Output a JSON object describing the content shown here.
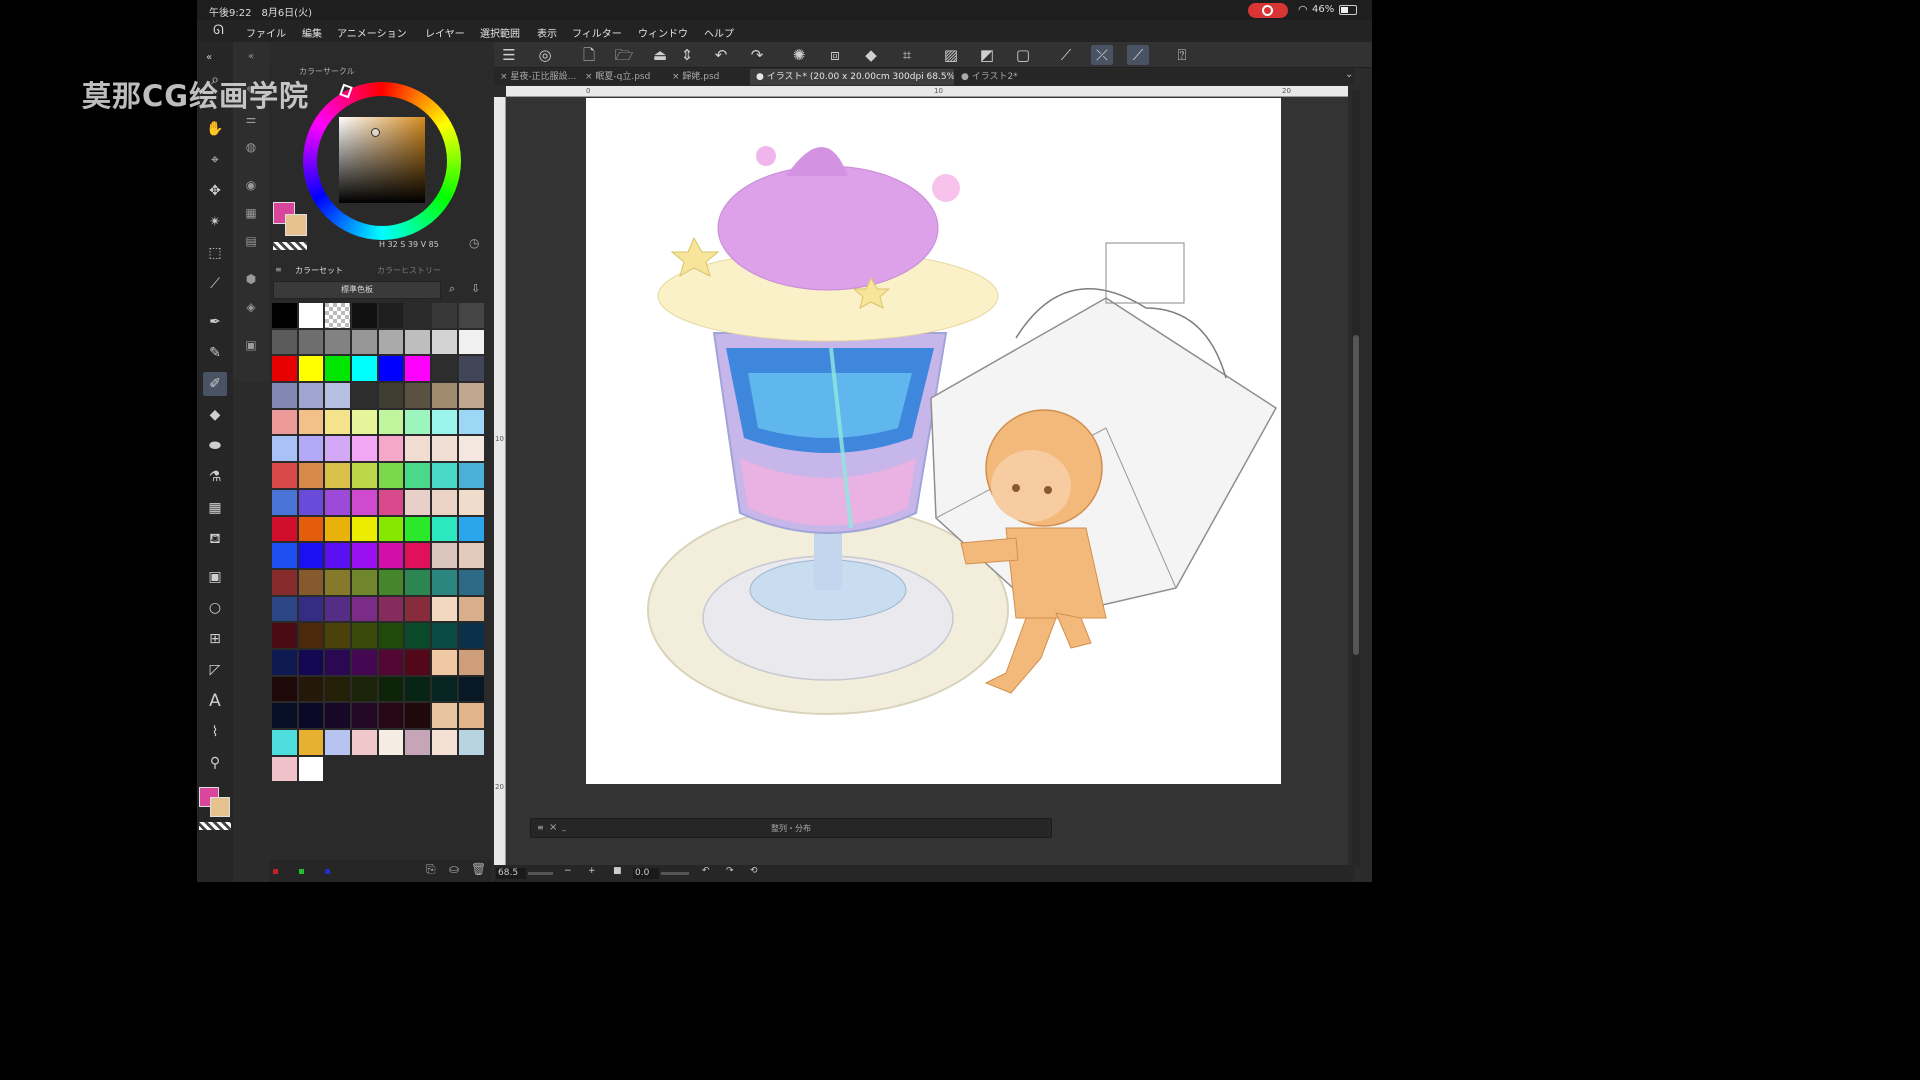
{
  "status_bar": {
    "time": "午後9:22　8月6日(火)",
    "battery": "46%"
  },
  "menu": [
    "ファイル",
    "編集",
    "アニメーション",
    "レイヤー",
    "選択範囲",
    "表示",
    "フィルター",
    "ウィンドウ",
    "ヘルプ"
  ],
  "tabs": [
    {
      "label": "× 星夜-正比服設..."
    },
    {
      "label": "× 眠夏-q立.psd"
    },
    {
      "label": "× 歸姥.psd"
    },
    {
      "label": "● イラスト* (20.00 x 20.00cm 300dpi 68.5%)"
    },
    {
      "label": "● イラスト2*"
    }
  ],
  "ruler": {
    "top": [
      "0",
      "10",
      "20"
    ],
    "left": [
      "10",
      "20"
    ]
  },
  "color_panel": {
    "title": "カラーサークル",
    "hsv": "H 32  S 39  V 85",
    "main_color": "#d9459a",
    "sub_color": "#e6c38e"
  },
  "color_set": {
    "tab_active": "カラーセット",
    "tab_inactive": "カラーヒストリー",
    "palette_name": "標準色板",
    "swatches": [
      "#000000",
      "#ffffff",
      "checker",
      "#111111",
      "#1e1e1e",
      "#2b2b2b",
      "#383838",
      "#454545",
      "#5a5a5a",
      "#6e6e6e",
      "#828282",
      "#969696",
      "#aaaaaa",
      "#bebebe",
      "#d2d2d2",
      "#f0f0f0",
      "#e60000",
      "#ffff00",
      "#00e600",
      "#00ffff",
      "#0000ff",
      "#ff00ff",
      "#2d2d2d",
      "#404658",
      "#7f87b2",
      "#9ea6cf",
      "#b7bfe0",
      "#2e2e2e",
      "#3f3d32",
      "#5b5140",
      "#a08a6e",
      "#c1a78e",
      "#ef9a9a",
      "#f3c08a",
      "#f5e38c",
      "#e7f59a",
      "#bff59c",
      "#9cf5bd",
      "#9cf5ec",
      "#9cd8f5",
      "#a8c2f7",
      "#b3a8f7",
      "#d2a8f7",
      "#f2a8f5",
      "#f5a8c9",
      "#f0dcd0",
      "#f1ded5",
      "#f3e7e0",
      "#d84a4a",
      "#d88a4a",
      "#d8c04a",
      "#bcd84a",
      "#7bd84a",
      "#4ad88a",
      "#4ad8c6",
      "#4ab0d8",
      "#4a73d8",
      "#6a4ad8",
      "#9d4ad8",
      "#d04ad0",
      "#d84a8c",
      "#e8d0c8",
      "#ead3c5",
      "#f0dccb",
      "#d10e2b",
      "#e35d0b",
      "#e8b20a",
      "#ecec00",
      "#86e800",
      "#2be82b",
      "#2be8c0",
      "#2ba6ec",
      "#1e4ff0",
      "#1a10f0",
      "#5a10f0",
      "#9a10f0",
      "#d010a8",
      "#e0105a",
      "#dcc5bc",
      "#e3cbbb",
      "#862c2c",
      "#865a2c",
      "#86792c",
      "#6f862c",
      "#45862c",
      "#2c8651",
      "#2c8680",
      "#2c6a86",
      "#2c4686",
      "#352c86",
      "#552c86",
      "#7a2c86",
      "#862c5c",
      "#862c3a",
      "#f2d8c0",
      "#d9ae8a",
      "#4a0a12",
      "#4a2a0a",
      "#4a420a",
      "#3a4a0a",
      "#1f4a0a",
      "#0a4a2a",
      "#0a4a45",
      "#0a304a",
      "#101a52",
      "#140852",
      "#2a0852",
      "#440852",
      "#520832",
      "#520818",
      "#efc9a4",
      "#cf9e7a",
      "#1f0808",
      "#241808",
      "#242008",
      "#1b2408",
      "#0d2408",
      "#082414",
      "#082422",
      "#081824",
      "#081028",
      "#0c0828",
      "#180828",
      "#240826",
      "#280816",
      "#20080c",
      "#e9c4a0",
      "#e1b48c",
      "#4fdede",
      "#e8b030",
      "#b8c4f0",
      "#f0c8cc",
      "#f5ece4",
      "#c7a5b8",
      "#f4e0d4",
      "#b8d4e0",
      "#eec2c8",
      "#ffffff"
    ]
  },
  "canvas": {
    "zoom": "68.5",
    "rotation": "0.0"
  },
  "floating_panel": {
    "title": "整列・分布"
  },
  "watermark": "莫那CG绘画学院",
  "colors": {
    "accent_active": "#4a5363",
    "panel_bg": "#2a2a2a",
    "record": "#d93535"
  }
}
